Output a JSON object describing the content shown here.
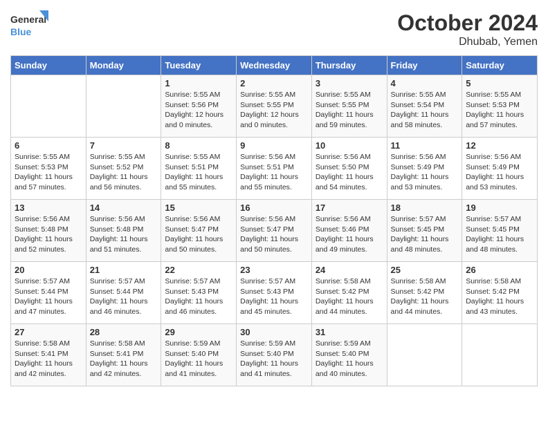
{
  "logo": {
    "general": "General",
    "blue": "Blue"
  },
  "title": "October 2024",
  "location": "Dhubab, Yemen",
  "days_of_week": [
    "Sunday",
    "Monday",
    "Tuesday",
    "Wednesday",
    "Thursday",
    "Friday",
    "Saturday"
  ],
  "weeks": [
    [
      {
        "day": "",
        "info": ""
      },
      {
        "day": "",
        "info": ""
      },
      {
        "day": "1",
        "info": "Sunrise: 5:55 AM\nSunset: 5:56 PM\nDaylight: 12 hours\nand 0 minutes."
      },
      {
        "day": "2",
        "info": "Sunrise: 5:55 AM\nSunset: 5:55 PM\nDaylight: 12 hours\nand 0 minutes."
      },
      {
        "day": "3",
        "info": "Sunrise: 5:55 AM\nSunset: 5:55 PM\nDaylight: 11 hours\nand 59 minutes."
      },
      {
        "day": "4",
        "info": "Sunrise: 5:55 AM\nSunset: 5:54 PM\nDaylight: 11 hours\nand 58 minutes."
      },
      {
        "day": "5",
        "info": "Sunrise: 5:55 AM\nSunset: 5:53 PM\nDaylight: 11 hours\nand 57 minutes."
      }
    ],
    [
      {
        "day": "6",
        "info": "Sunrise: 5:55 AM\nSunset: 5:53 PM\nDaylight: 11 hours\nand 57 minutes."
      },
      {
        "day": "7",
        "info": "Sunrise: 5:55 AM\nSunset: 5:52 PM\nDaylight: 11 hours\nand 56 minutes."
      },
      {
        "day": "8",
        "info": "Sunrise: 5:55 AM\nSunset: 5:51 PM\nDaylight: 11 hours\nand 55 minutes."
      },
      {
        "day": "9",
        "info": "Sunrise: 5:56 AM\nSunset: 5:51 PM\nDaylight: 11 hours\nand 55 minutes."
      },
      {
        "day": "10",
        "info": "Sunrise: 5:56 AM\nSunset: 5:50 PM\nDaylight: 11 hours\nand 54 minutes."
      },
      {
        "day": "11",
        "info": "Sunrise: 5:56 AM\nSunset: 5:49 PM\nDaylight: 11 hours\nand 53 minutes."
      },
      {
        "day": "12",
        "info": "Sunrise: 5:56 AM\nSunset: 5:49 PM\nDaylight: 11 hours\nand 53 minutes."
      }
    ],
    [
      {
        "day": "13",
        "info": "Sunrise: 5:56 AM\nSunset: 5:48 PM\nDaylight: 11 hours\nand 52 minutes."
      },
      {
        "day": "14",
        "info": "Sunrise: 5:56 AM\nSunset: 5:48 PM\nDaylight: 11 hours\nand 51 minutes."
      },
      {
        "day": "15",
        "info": "Sunrise: 5:56 AM\nSunset: 5:47 PM\nDaylight: 11 hours\nand 50 minutes."
      },
      {
        "day": "16",
        "info": "Sunrise: 5:56 AM\nSunset: 5:47 PM\nDaylight: 11 hours\nand 50 minutes."
      },
      {
        "day": "17",
        "info": "Sunrise: 5:56 AM\nSunset: 5:46 PM\nDaylight: 11 hours\nand 49 minutes."
      },
      {
        "day": "18",
        "info": "Sunrise: 5:57 AM\nSunset: 5:45 PM\nDaylight: 11 hours\nand 48 minutes."
      },
      {
        "day": "19",
        "info": "Sunrise: 5:57 AM\nSunset: 5:45 PM\nDaylight: 11 hours\nand 48 minutes."
      }
    ],
    [
      {
        "day": "20",
        "info": "Sunrise: 5:57 AM\nSunset: 5:44 PM\nDaylight: 11 hours\nand 47 minutes."
      },
      {
        "day": "21",
        "info": "Sunrise: 5:57 AM\nSunset: 5:44 PM\nDaylight: 11 hours\nand 46 minutes."
      },
      {
        "day": "22",
        "info": "Sunrise: 5:57 AM\nSunset: 5:43 PM\nDaylight: 11 hours\nand 46 minutes."
      },
      {
        "day": "23",
        "info": "Sunrise: 5:57 AM\nSunset: 5:43 PM\nDaylight: 11 hours\nand 45 minutes."
      },
      {
        "day": "24",
        "info": "Sunrise: 5:58 AM\nSunset: 5:42 PM\nDaylight: 11 hours\nand 44 minutes."
      },
      {
        "day": "25",
        "info": "Sunrise: 5:58 AM\nSunset: 5:42 PM\nDaylight: 11 hours\nand 44 minutes."
      },
      {
        "day": "26",
        "info": "Sunrise: 5:58 AM\nSunset: 5:42 PM\nDaylight: 11 hours\nand 43 minutes."
      }
    ],
    [
      {
        "day": "27",
        "info": "Sunrise: 5:58 AM\nSunset: 5:41 PM\nDaylight: 11 hours\nand 42 minutes."
      },
      {
        "day": "28",
        "info": "Sunrise: 5:58 AM\nSunset: 5:41 PM\nDaylight: 11 hours\nand 42 minutes."
      },
      {
        "day": "29",
        "info": "Sunrise: 5:59 AM\nSunset: 5:40 PM\nDaylight: 11 hours\nand 41 minutes."
      },
      {
        "day": "30",
        "info": "Sunrise: 5:59 AM\nSunset: 5:40 PM\nDaylight: 11 hours\nand 41 minutes."
      },
      {
        "day": "31",
        "info": "Sunrise: 5:59 AM\nSunset: 5:40 PM\nDaylight: 11 hours\nand 40 minutes."
      },
      {
        "day": "",
        "info": ""
      },
      {
        "day": "",
        "info": ""
      }
    ]
  ]
}
